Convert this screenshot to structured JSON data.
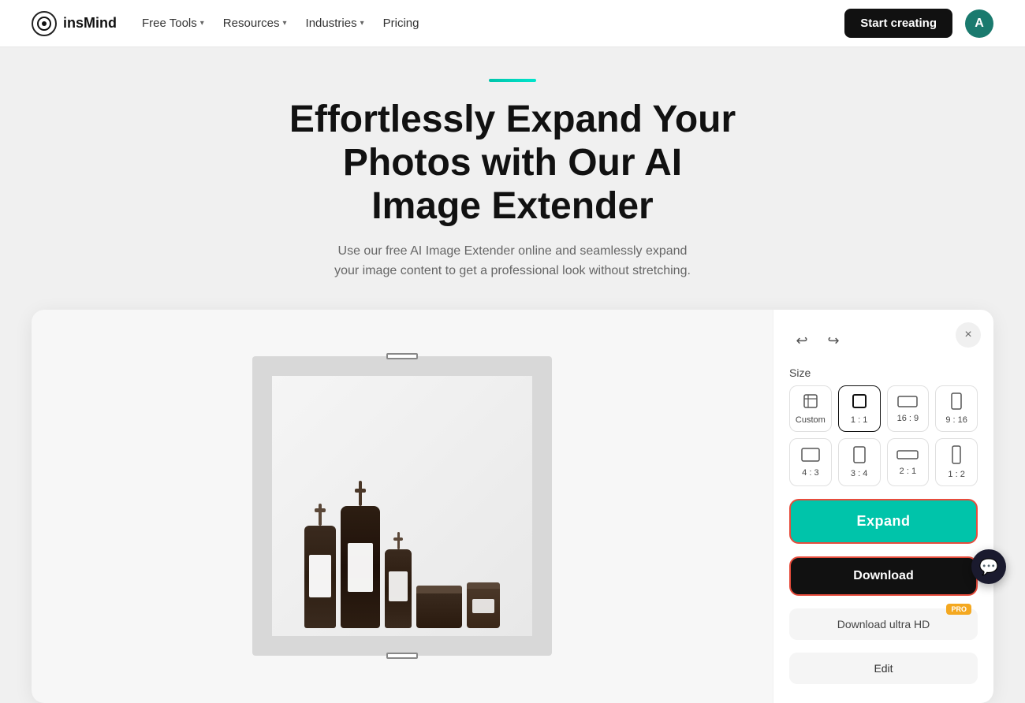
{
  "navbar": {
    "logo_text": "insMind",
    "nav_items": [
      {
        "label": "Free Tools",
        "has_dropdown": true
      },
      {
        "label": "Resources",
        "has_dropdown": true
      },
      {
        "label": "Industries",
        "has_dropdown": true
      },
      {
        "label": "Pricing",
        "has_dropdown": false
      }
    ],
    "start_btn": "Start creating",
    "avatar_initial": "A"
  },
  "hero": {
    "accent_line": true,
    "title_line1": "Effortlessly Expand Your",
    "title_line2": "Photos with Our AI",
    "title_line3": "Image Extender",
    "subtitle_line1": "Use our free AI Image Extender online and seamlessly expand",
    "subtitle_line2": "your image content to get a professional look without stretching."
  },
  "tool": {
    "close_label": "×",
    "undo_icon": "↩",
    "redo_icon": "↪",
    "size_section_label": "Size",
    "sizes": [
      {
        "label": "Custom",
        "icon": "⊞",
        "active": false
      },
      {
        "label": "1 : 1",
        "icon": "□",
        "active": true
      },
      {
        "label": "16 : 9",
        "icon": "▭",
        "active": false
      },
      {
        "label": "9 : 16",
        "icon": "▯",
        "active": false
      },
      {
        "label": "4 : 3",
        "icon": "▭",
        "active": false
      },
      {
        "label": "3 : 4",
        "icon": "▯",
        "active": false
      },
      {
        "label": "2 : 1",
        "icon": "▬",
        "active": false
      },
      {
        "label": "1 : 2",
        "icon": "▮",
        "active": false
      }
    ],
    "expand_btn": "Expand",
    "download_btn": "Download",
    "download_ultra_btn": "Download ultra HD",
    "pro_badge": "PRO",
    "edit_btn": "Edit"
  },
  "chat": {
    "icon": "💬"
  }
}
